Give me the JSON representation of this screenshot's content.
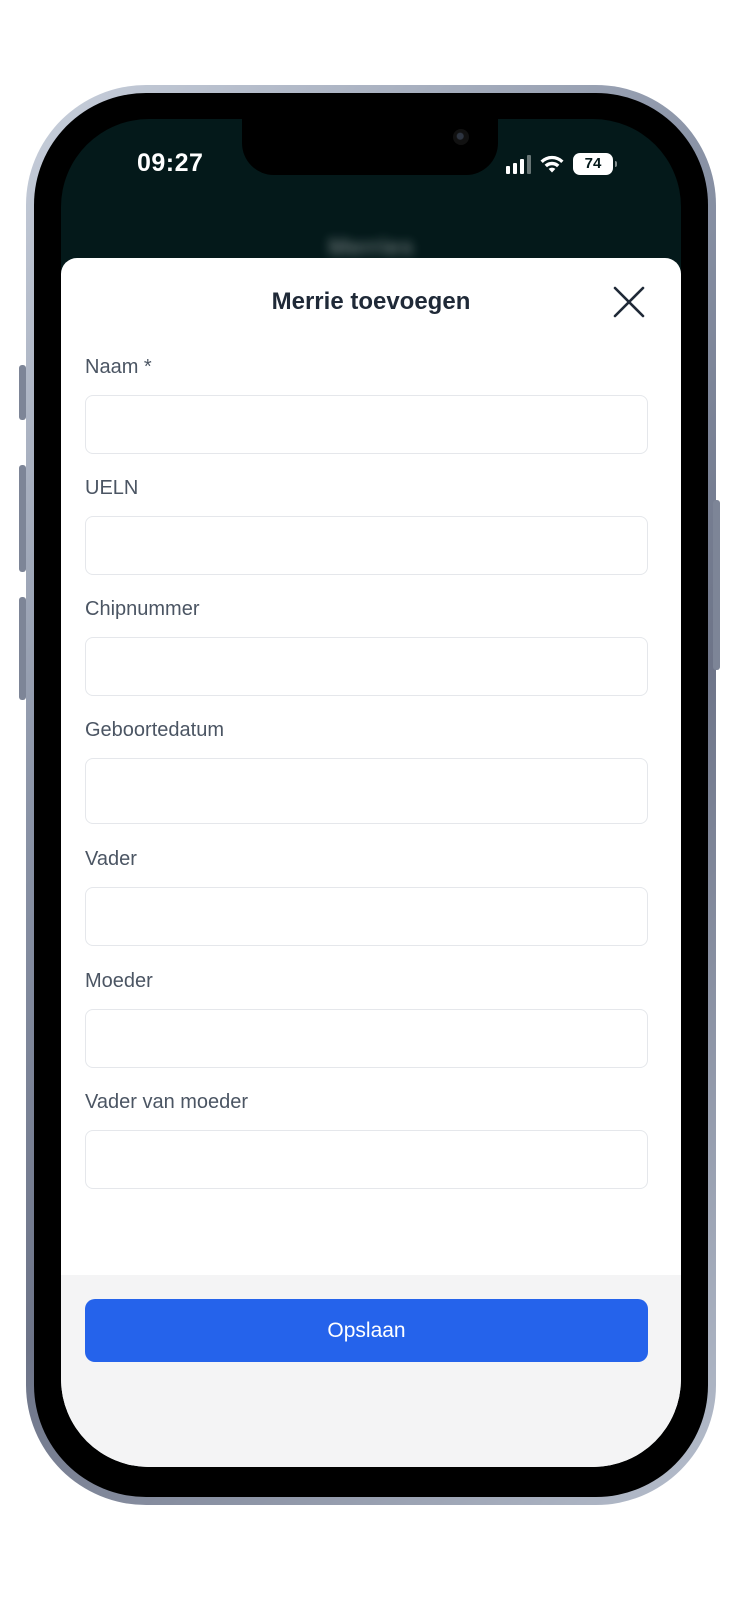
{
  "status_bar": {
    "time": "09:27",
    "battery": "74"
  },
  "background": {
    "title": "Merries"
  },
  "modal": {
    "title": "Merrie toevoegen",
    "close_icon": "close-icon",
    "fields": [
      {
        "label": "Naam *",
        "value": ""
      },
      {
        "label": "UELN",
        "value": ""
      },
      {
        "label": "Chipnummer",
        "value": ""
      },
      {
        "label": "Geboortedatum",
        "value": ""
      },
      {
        "label": "Vader",
        "value": ""
      },
      {
        "label": "Moeder",
        "value": ""
      },
      {
        "label": "Vader van moeder",
        "value": ""
      }
    ],
    "save_label": "Opslaan"
  },
  "colors": {
    "accent": "#2563eb",
    "header_bg": "#04191a",
    "label": "#4b5563",
    "title": "#1f2937"
  }
}
